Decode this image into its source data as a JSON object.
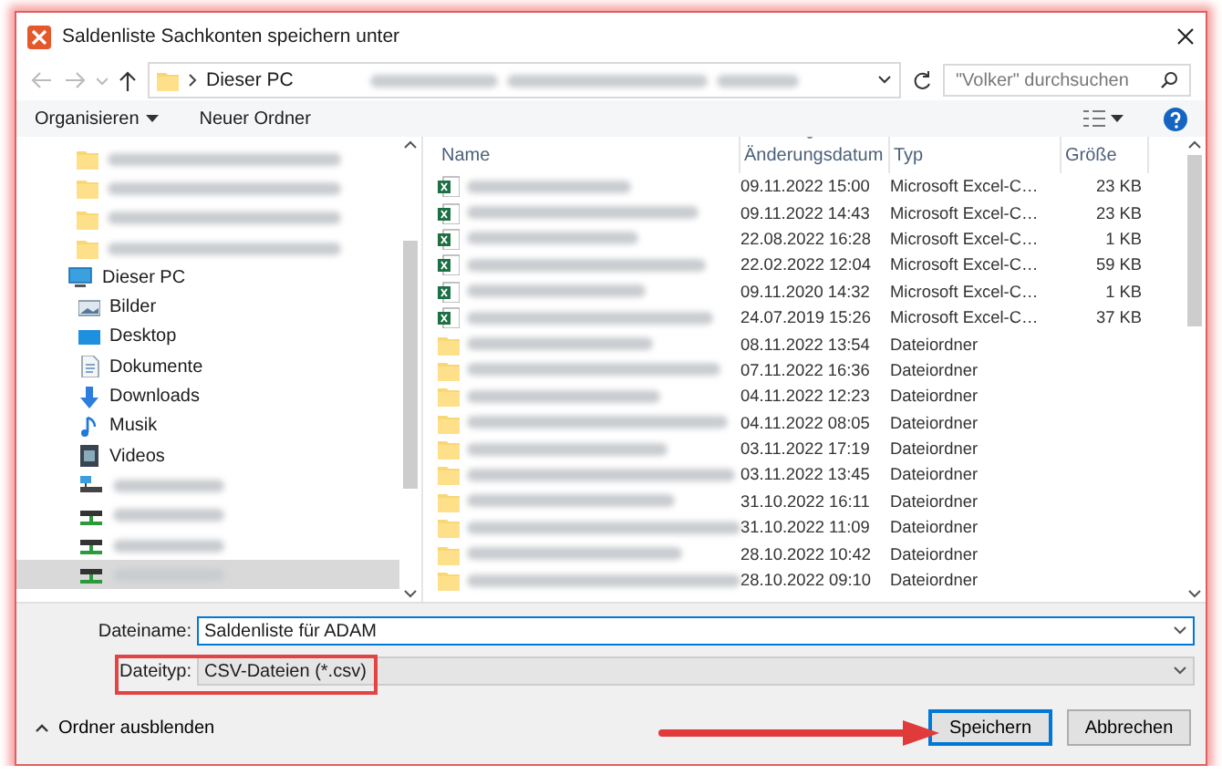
{
  "window": {
    "title": "Saldenliste Sachkonten speichern unter"
  },
  "address_bar": {
    "path": [
      "Dieser PC"
    ],
    "search": {
      "placeholder": "\"Volker\" durchsuchen"
    }
  },
  "toolbar": {
    "buttons": [
      {
        "label": "Organisieren",
        "dropdown": true
      },
      {
        "label": "Neuer Ordner",
        "dropdown": false
      }
    ]
  },
  "nav_pane": {
    "items": [
      {
        "kind": "folder",
        "selected": false
      },
      {
        "kind": "folder",
        "selected": false
      },
      {
        "kind": "folder",
        "selected": false
      },
      {
        "kind": "folder",
        "selected": false
      },
      {
        "kind": "pc",
        "label": "Dieser PC",
        "selected": false,
        "children": [
          {
            "kind": "pictures",
            "label": "Bilder",
            "selected": false
          },
          {
            "kind": "desktop",
            "label": "Desktop",
            "selected": false
          },
          {
            "kind": "documents",
            "label": "Dokumente",
            "selected": false
          },
          {
            "kind": "downloads",
            "label": "Downloads",
            "selected": false
          },
          {
            "kind": "music",
            "label": "Musik",
            "selected": false
          },
          {
            "kind": "videos",
            "label": "Videos",
            "selected": false
          },
          {
            "kind": "network",
            "selected": false
          },
          {
            "kind": "drive",
            "selected": false
          },
          {
            "kind": "drive",
            "selected": false
          },
          {
            "kind": "drive",
            "selected": true
          }
        ]
      }
    ]
  },
  "file_list": {
    "columns": [
      {
        "label": "Name",
        "sorted": false
      },
      {
        "label": "Änderungsdatum",
        "sorted": true
      },
      {
        "label": "Typ",
        "sorted": false
      },
      {
        "label": "Größe",
        "sorted": false
      }
    ],
    "rows": [
      {
        "kind": "excel",
        "modified": "09.11.2022 15:00",
        "type": "Microsoft Excel-C…",
        "size": "23 KB"
      },
      {
        "kind": "excel",
        "modified": "09.11.2022 14:43",
        "type": "Microsoft Excel-C…",
        "size": "23 KB"
      },
      {
        "kind": "excel",
        "modified": "22.08.2022 16:28",
        "type": "Microsoft Excel-C…",
        "size": "1 KB"
      },
      {
        "kind": "excel",
        "modified": "22.02.2022 12:04",
        "type": "Microsoft Excel-C…",
        "size": "59 KB"
      },
      {
        "kind": "excel",
        "modified": "09.11.2020 14:32",
        "type": "Microsoft Excel-C…",
        "size": "1 KB"
      },
      {
        "kind": "excel",
        "modified": "24.07.2019 15:26",
        "type": "Microsoft Excel-C…",
        "size": "37 KB"
      },
      {
        "kind": "folder",
        "modified": "08.11.2022 13:54",
        "type": "Dateiordner"
      },
      {
        "kind": "folder",
        "modified": "07.11.2022 16:36",
        "type": "Dateiordner"
      },
      {
        "kind": "folder",
        "modified": "04.11.2022 12:23",
        "type": "Dateiordner"
      },
      {
        "kind": "folder",
        "modified": "04.11.2022 08:05",
        "type": "Dateiordner"
      },
      {
        "kind": "folder",
        "modified": "03.11.2022 17:19",
        "type": "Dateiordner"
      },
      {
        "kind": "folder",
        "modified": "03.11.2022 13:45",
        "type": "Dateiordner"
      },
      {
        "kind": "folder",
        "modified": "31.10.2022 16:11",
        "type": "Dateiordner"
      },
      {
        "kind": "folder",
        "modified": "31.10.2022 11:09",
        "type": "Dateiordner"
      },
      {
        "kind": "folder",
        "modified": "28.10.2022 10:42",
        "type": "Dateiordner"
      },
      {
        "kind": "folder",
        "modified": "28.10.2022 09:10",
        "type": "Dateiordner"
      }
    ]
  },
  "save_panel": {
    "filename": {
      "label": "Dateiname:",
      "value": "Saldenliste für ADAM",
      "highlighted": false
    },
    "filetype": {
      "label": "Dateityp:",
      "value": "CSV-Dateien (*.csv)",
      "highlighted": true
    },
    "hide_folders": "Ordner ausblenden",
    "buttons": [
      {
        "label": "Speichern",
        "default": true,
        "pointed_at": true
      },
      {
        "label": "Abbrechen",
        "default": false,
        "pointed_at": false
      }
    ]
  }
}
